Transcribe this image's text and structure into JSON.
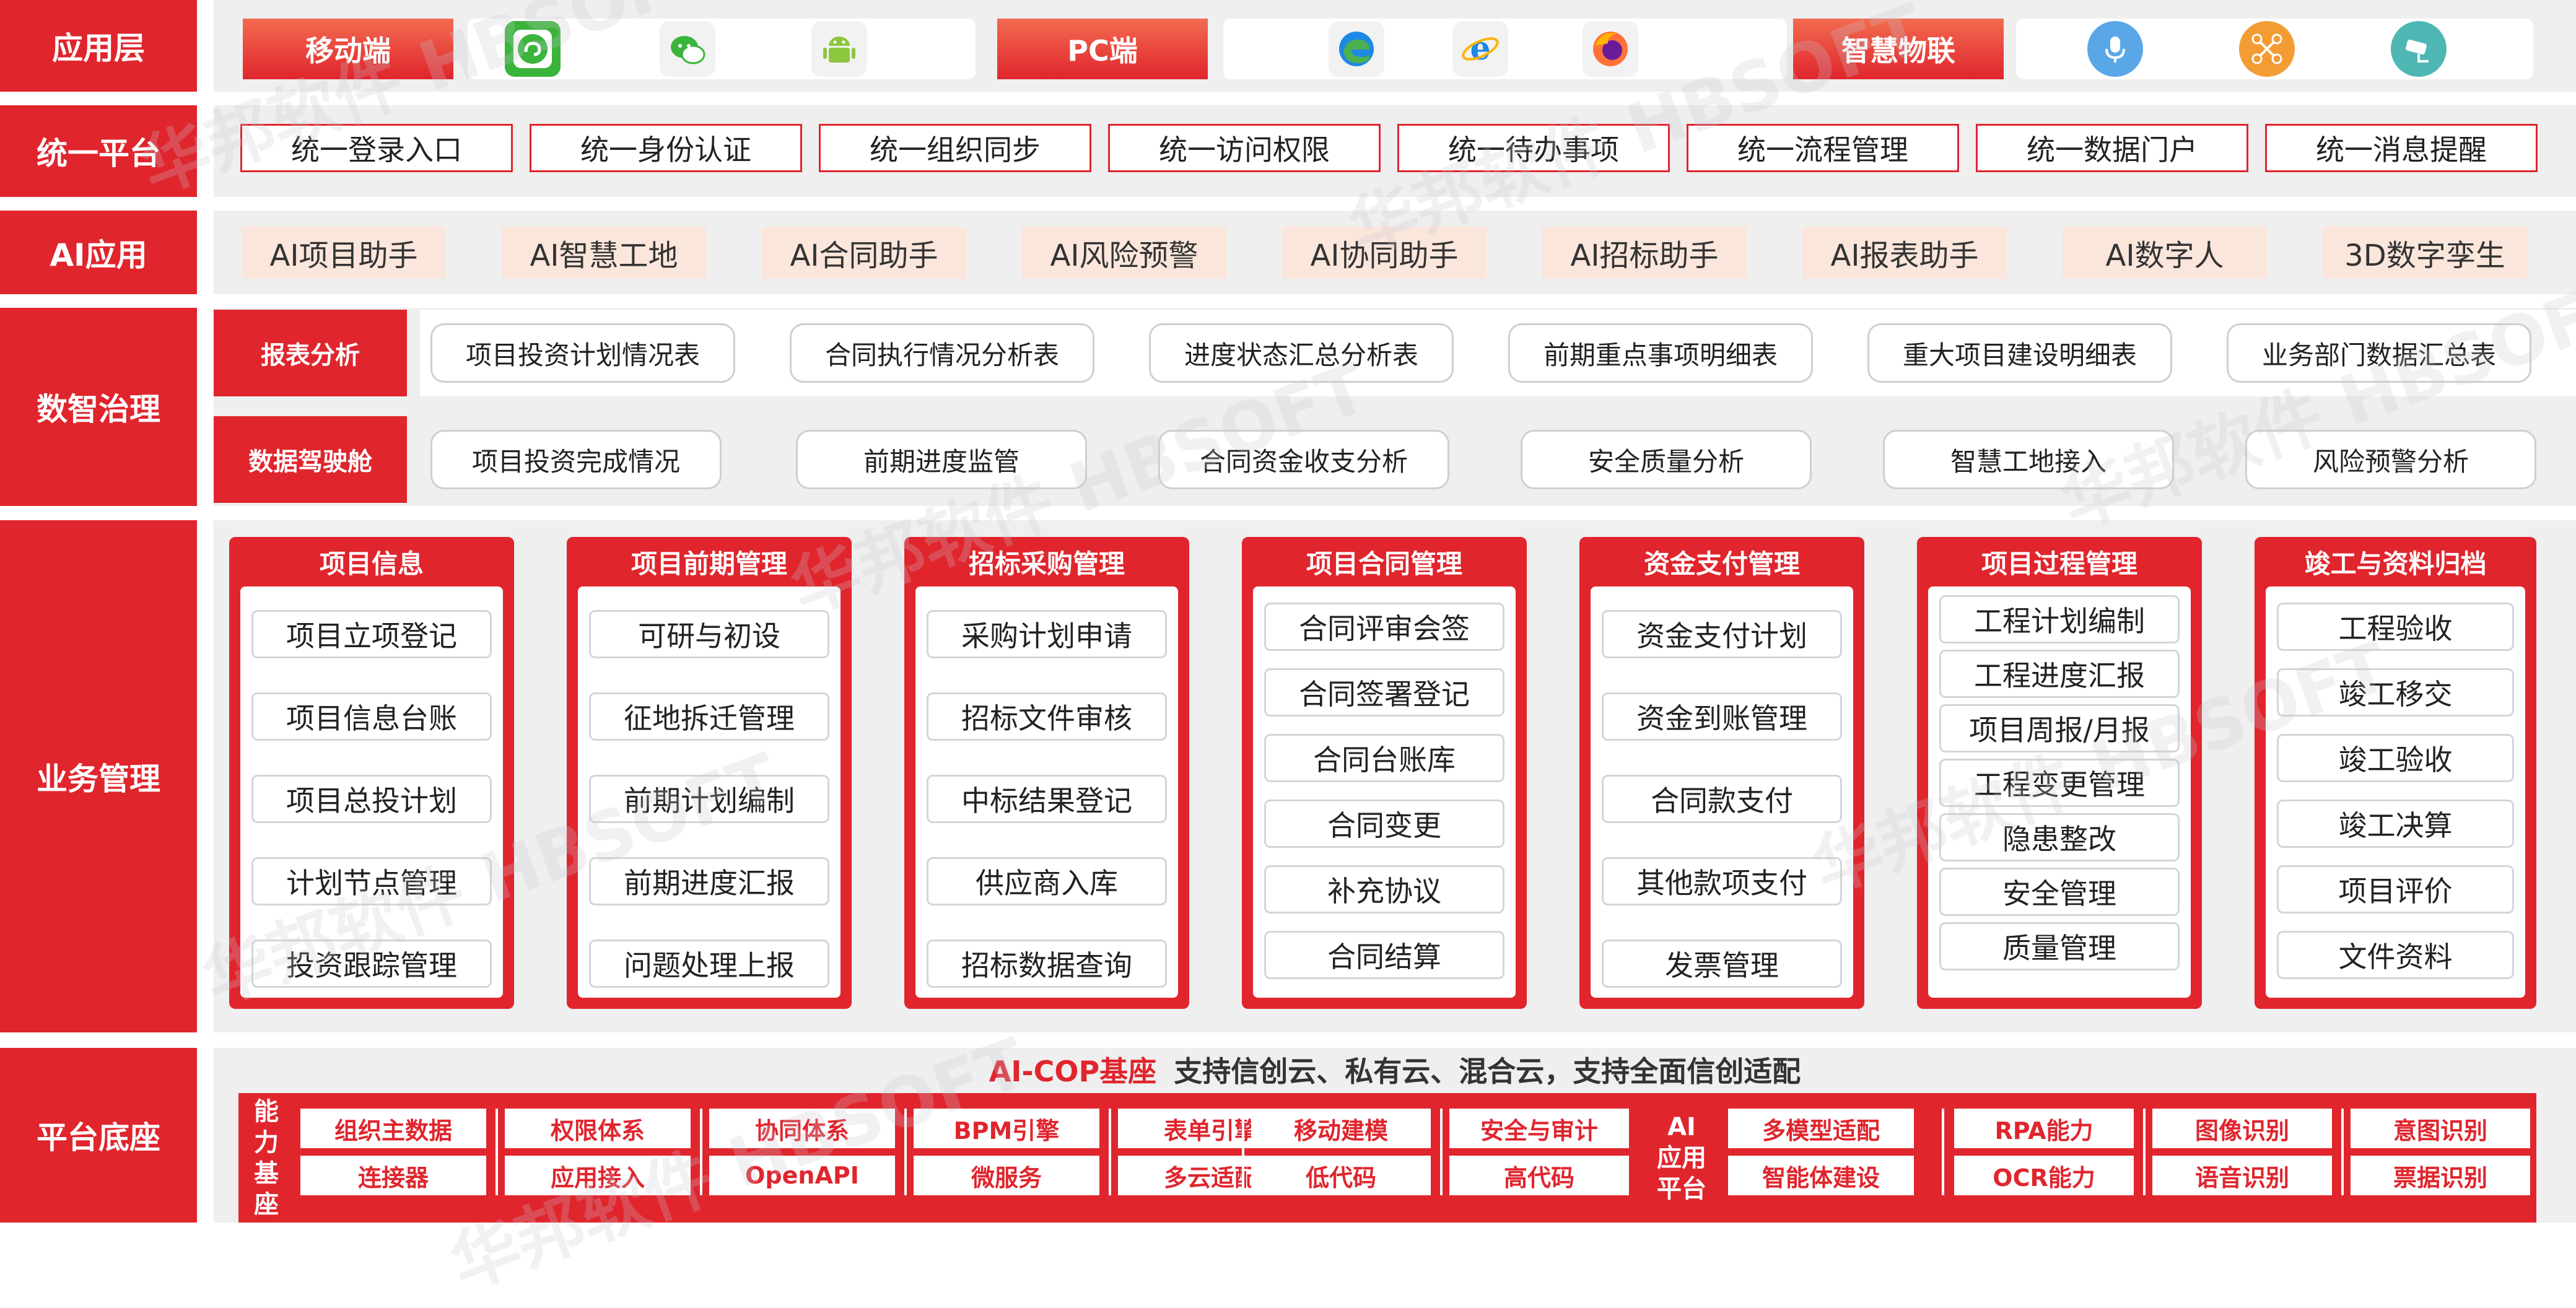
{
  "colors": {
    "red": "#e0252d",
    "gradient_top": "#f26b4f",
    "light_bg": "#efefef",
    "ai_bg": "#fbe6dc",
    "cap_text": "#e0252d"
  },
  "rows": {
    "app": "应用层",
    "unified": "统一平台",
    "ai": "AI应用",
    "gov": "数智治理",
    "biz": "业务管理",
    "base": "平台底座"
  },
  "app_layer": {
    "mobile": "移动端",
    "pc": "PC端",
    "iot": "智慧物联",
    "mobile_icons": [
      "mini-program-icon",
      "wechat-icon",
      "android-icon"
    ],
    "pc_icons": [
      "edge-icon",
      "ie-icon",
      "firefox-icon"
    ],
    "iot_icons": [
      "microphone-icon",
      "drone-icon",
      "camera-icon"
    ]
  },
  "unified_items": [
    "统一登录入口",
    "统一身份认证",
    "统一组织同步",
    "统一访问权限",
    "统一待办事项",
    "统一流程管理",
    "统一数据门户",
    "统一消息提醒"
  ],
  "ai_items": [
    "AI项目助手",
    "AI智慧工地",
    "AI合同助手",
    "AI风险预警",
    "AI协同助手",
    "AI招标助手",
    "AI报表助手",
    "AI数字人",
    "3D数字孪生"
  ],
  "gov": {
    "report_tag": "报表分析",
    "report_items": [
      "项目投资计划情况表",
      "合同执行情况分析表",
      "进度状态汇总分析表",
      "前期重点事项明细表",
      "重大项目建设明细表",
      "业务部门数据汇总表"
    ],
    "cockpit_tag": "数据驾驶舱",
    "cockpit_items": [
      "项目投资完成情况",
      "前期进度监管",
      "合同资金收支分析",
      "安全质量分析",
      "智慧工地接入",
      "风险预警分析"
    ]
  },
  "biz_columns": [
    {
      "title": "项目信息",
      "items": [
        "项目立项登记",
        "项目信息台账",
        "项目总投计划",
        "计划节点管理",
        "投资跟踪管理"
      ]
    },
    {
      "title": "项目前期管理",
      "items": [
        "可研与初设",
        "征地拆迁管理",
        "前期计划编制",
        "前期进度汇报",
        "问题处理上报"
      ]
    },
    {
      "title": "招标采购管理",
      "items": [
        "采购计划申请",
        "招标文件审核",
        "中标结果登记",
        "供应商入库",
        "招标数据查询"
      ]
    },
    {
      "title": "项目合同管理",
      "items": [
        "合同评审会签",
        "合同签署登记",
        "合同台账库",
        "合同变更",
        "补充协议",
        "合同结算"
      ]
    },
    {
      "title": "资金支付管理",
      "items": [
        "资金支付计划",
        "资金到账管理",
        "合同款支付",
        "其他款项支付",
        "发票管理"
      ]
    },
    {
      "title": "项目过程管理",
      "items": [
        "工程计划编制",
        "工程进度汇报",
        "项目周报/月报",
        "工程变更管理",
        "隐患整改",
        "安全管理",
        "质量管理"
      ]
    },
    {
      "title": "竣工与资料归档",
      "items": [
        "工程验收",
        "竣工移交",
        "竣工验收",
        "竣工决算",
        "项目评价",
        "文件资料"
      ]
    }
  ],
  "base": {
    "headline_red": "AI-COP基座",
    "headline_rest": "支持信创云、私有云、混合云，支持全面信创适配",
    "cap_label_chars": [
      "能",
      "力",
      "基",
      "座"
    ],
    "cap_pairs": [
      [
        "组织主数据",
        "连接器"
      ],
      [
        "权限体系",
        "应用接入"
      ],
      [
        "协同体系",
        "OpenAPI"
      ],
      [
        "BPM引擎",
        "微服务"
      ],
      [
        "表单引擎",
        "多云适配"
      ],
      [
        "移动建模",
        "低代码"
      ],
      [
        "安全与审计",
        "高代码"
      ]
    ],
    "ai_label_lines": [
      "AI",
      "应用",
      "平台"
    ],
    "ai_pairs": [
      [
        "多模型适配",
        "智能体建设"
      ],
      [
        "RPA能力",
        "OCR能力"
      ],
      [
        "图像识别",
        "语音识别"
      ],
      [
        "意图识别",
        "票据识别"
      ]
    ]
  },
  "watermark": {
    "cn": "华邦软件",
    "en": "HBSOFT"
  }
}
